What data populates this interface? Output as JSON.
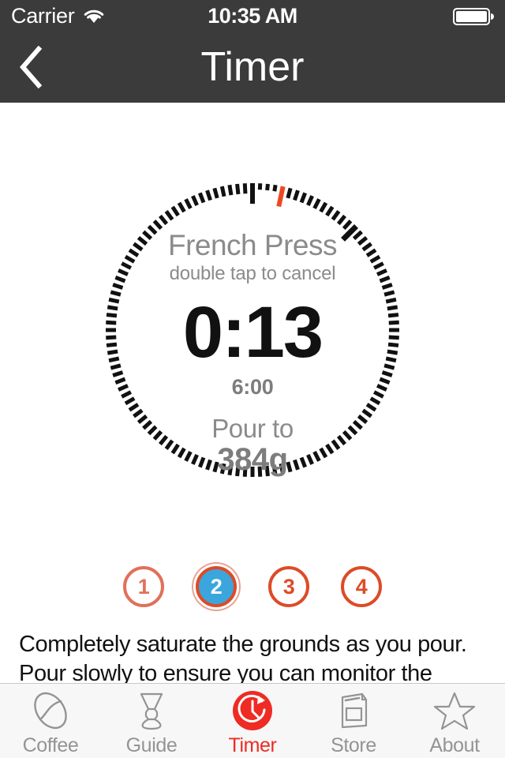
{
  "status_bar": {
    "carrier": "Carrier",
    "wifi_icon": "wifi-icon",
    "time": "10:35 AM",
    "battery_icon": "battery-full-icon"
  },
  "nav_bar": {
    "back_icon": "chevron-left-icon",
    "title": "Timer"
  },
  "timer": {
    "brew_method": "French Press",
    "cancel_hint": "double tap to cancel",
    "elapsed": "0:13",
    "total": "6:00",
    "pour_label": "Pour to",
    "pour_amount": "384g",
    "elapsed_seconds": 13,
    "total_seconds": 360,
    "tick_count": 120,
    "marker_color": "#ee4822",
    "tick_color": "#111111"
  },
  "steps": {
    "items": [
      {
        "label": "1",
        "state": "done"
      },
      {
        "label": "2",
        "state": "active"
      },
      {
        "label": "3",
        "state": "upcoming"
      },
      {
        "label": "4",
        "state": "upcoming"
      }
    ],
    "done_color": "#e1705a",
    "upcoming_color": "#dd4b27",
    "active_fill": "#3ba6dd",
    "active_ring": "#dd4b27"
  },
  "instructions": {
    "text": "Completely saturate the grounds as you pour. Pour slowly to ensure you can monitor the scale display"
  },
  "tab_bar": {
    "active_color": "#ee2b24",
    "inactive_color": "#949494",
    "items": [
      {
        "label": "Coffee",
        "icon": "coffee-bean-icon",
        "active": false
      },
      {
        "label": "Guide",
        "icon": "chemex-brewer-icon",
        "active": false
      },
      {
        "label": "Timer",
        "icon": "clock-timer-icon",
        "active": true
      },
      {
        "label": "Store",
        "icon": "coffee-bag-icon",
        "active": false
      },
      {
        "label": "About",
        "icon": "star-icon",
        "active": false
      }
    ]
  }
}
